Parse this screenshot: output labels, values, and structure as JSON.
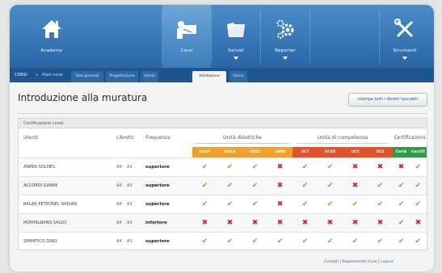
{
  "nav": {
    "items": [
      {
        "label": "Academy",
        "icon": "home-icon"
      },
      {
        "label": "Corsi",
        "icon": "teacher-icon"
      },
      {
        "label": "Servizi",
        "icon": "folder-icon"
      },
      {
        "label": "Reporter",
        "icon": "gears-icon"
      },
      {
        "label": "Strumenti",
        "icon": "tools-icon"
      }
    ]
  },
  "subbar": {
    "crumb_root": "CORSI",
    "crumb_sep": "»",
    "crumb_current": "Piani corsi",
    "tabs": [
      "Dati generali",
      "Progettazione",
      "Utenti",
      "Validazione",
      "Diario"
    ],
    "active_tab": "Validazione"
  },
  "page": {
    "title": "Introduzione alla muratura",
    "print_button": "stampa tutti i libretti tascabili"
  },
  "panel": {
    "header": "Certificazione corso",
    "columns": {
      "utenti": "Utenti",
      "libretti": "Libretti",
      "frequenza": "Frequenza",
      "ud": "Unità didattiche",
      "uc": "Unità di competenza",
      "cert": "Certificazioni"
    },
    "ud_codes": [
      "UD43",
      "UD19",
      "UD52",
      "UD98"
    ],
    "uc_codes": [
      "UC7",
      "UC45",
      "UC5",
      "UC2"
    ],
    "cert_codes": [
      "Cert6",
      "Cert35"
    ],
    "colors": {
      "ud": "#f0a12b",
      "uc": "#e2532c",
      "cert": "#2f9a47",
      "ok": "#6fb43a",
      "no": "#d8232a"
    },
    "rows": [
      {
        "name": "ANREA SOLMES",
        "lib1": "A4",
        "lib2": "A3",
        "freq": "superiore",
        "marks": [
          "ok",
          "ok",
          "ok",
          "no",
          "ok",
          "ok",
          "no",
          "no",
          "no",
          "ok"
        ]
      },
      {
        "name": "ACCORDI GIANNI",
        "lib1": "A4",
        "lib2": "A3",
        "freq": "superiore",
        "marks": [
          "ok",
          "ok",
          "ok",
          "no",
          "ok",
          "ok",
          "no",
          "ok",
          "ok",
          "ok"
        ]
      },
      {
        "name": "BALAN PETRONEL NADIAN",
        "lib1": "A4",
        "lib2": "A3",
        "freq": "superiore",
        "marks": [
          "ok",
          "ok",
          "ok",
          "no",
          "ok",
          "ok",
          "ok",
          "ok",
          "ok",
          "ok"
        ]
      },
      {
        "name": "MONTALBANO SALVO",
        "lib1": "A4",
        "lib2": "A3",
        "freq": "inferiore",
        "marks": [
          "no",
          "no",
          "no",
          "no",
          "no",
          "no",
          "no",
          "no",
          "ok",
          "no"
        ]
      },
      {
        "name": "SIMPATICO GINO",
        "lib1": "A4",
        "lib2": "A3",
        "freq": "superiore",
        "marks": [
          "ok",
          "ok",
          "ok",
          "ok",
          "ok",
          "ok",
          "ok",
          "ok",
          "ok",
          "ok"
        ]
      }
    ]
  },
  "footer": {
    "links": "Contatti | Regolamento d'uso | Logout"
  }
}
